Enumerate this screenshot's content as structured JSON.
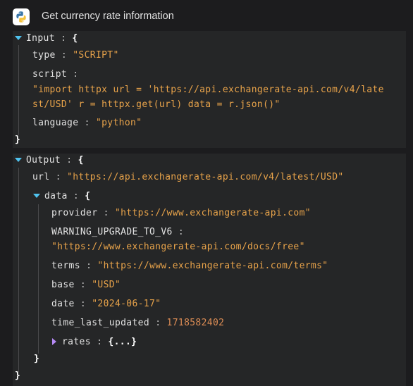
{
  "header": {
    "title": "Get currency rate information",
    "icon": "python-logo-icon"
  },
  "input": {
    "label": "Input",
    "type_key": "type",
    "type_value": "\"SCRIPT\"",
    "script_key": "script",
    "script_value_line1": "\"import httpx url = 'https://api.exchangerate-api.com/v4/late",
    "script_value_line2": "st/USD' r = httpx.get(url) data = r.json()\"",
    "language_key": "language",
    "language_value": "\"python\""
  },
  "output": {
    "label": "Output",
    "url_key": "url",
    "url_value": "\"https://api.exchangerate-api.com/v4/latest/USD\"",
    "data_label": "data",
    "provider_key": "provider",
    "provider_value": "\"https://www.exchangerate-api.com\"",
    "warning_key": "WARNING_UPGRADE_TO_V6",
    "warning_value": "\"https://www.exchangerate-api.com/docs/free\"",
    "terms_key": "terms",
    "terms_value": "\"https://www.exchangerate-api.com/terms\"",
    "base_key": "base",
    "base_value": "\"USD\"",
    "date_key": "date",
    "date_value": "\"2024-06-17\"",
    "time_key": "time_last_updated",
    "time_value": "1718582402",
    "rates_key": "rates",
    "rates_collapsed": "{...}"
  },
  "colors": {
    "background": "#1c1c1e",
    "panel": "#252627",
    "string": "#e8a34a",
    "number": "#dd8d55",
    "expand_arrow": "#4fc3ef",
    "collapsed_arrow": "#b68af5"
  }
}
